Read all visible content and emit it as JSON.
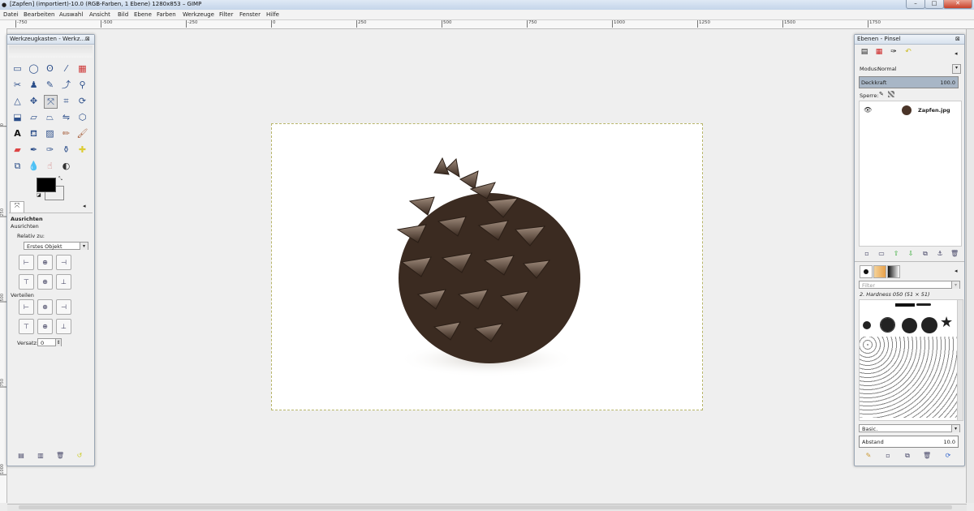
{
  "window": {
    "title": "[Zapfen] (importiert)-10.0 (RGB-Farben, 1 Ebene) 1280x853 – GIMP"
  },
  "menubar": [
    "Datei",
    "Bearbeiten",
    "Auswahl",
    "Ansicht",
    "Bild",
    "Ebene",
    "Farben",
    "Werkzeuge",
    "Filter",
    "Fenster",
    "Hilfe"
  ],
  "ruler": {
    "h_ticks": [
      "-750",
      "-500",
      "-250",
      "0",
      "250",
      "500",
      "750",
      "1000",
      "1250",
      "1500",
      "1750"
    ],
    "v_ticks": [
      "0",
      "250",
      "500",
      "750",
      "1000",
      "1250"
    ]
  },
  "toolbox": {
    "title": "Werkzeugkasten - Werkz...",
    "section": "Ausrichten",
    "subsection": "Ausrichten",
    "relative_label": "Relativ zu:",
    "relative_value": "Erstes Objekt",
    "distribute_label": "Verteilen",
    "offset_label": "Versatz:",
    "offset_value": "0"
  },
  "layers": {
    "title": "Ebenen - Pinsel",
    "mode_label": "Modus:",
    "mode_value": "Normal",
    "opacity_label": "Deckkraft",
    "opacity_value": "100.0",
    "lock_label": "Sperre:",
    "layer_name": "Zapfen.jpg"
  },
  "brushes": {
    "filter_placeholder": "Filter",
    "brush_name": "2. Hardness 050 (51 × 51)",
    "preset": "Basic.",
    "spacing_label": "Abstand",
    "spacing_value": "10.0"
  },
  "colors": {
    "foreground": "#000000",
    "background": "#ffffff",
    "accent": "#2d4f8a"
  }
}
